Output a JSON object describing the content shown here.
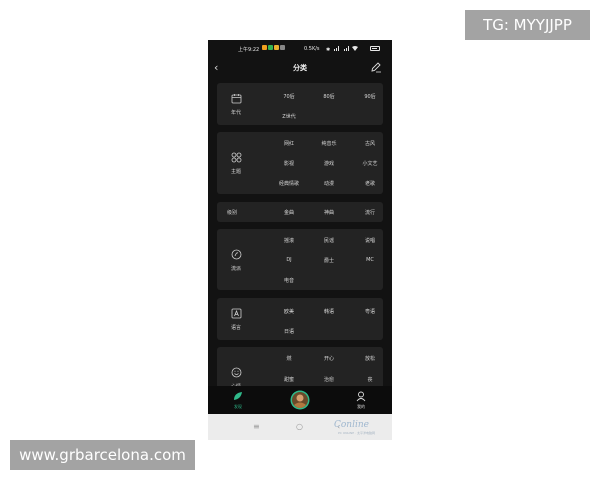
{
  "watermarks": {
    "top_right": "TG: MYYJJPP",
    "bottom_left": "www.grbarcelona.com"
  },
  "status_bar": {
    "time": "上午9:22",
    "right": "0.5K/s"
  },
  "header": {
    "title": "分类"
  },
  "sections": {
    "era": {
      "label": "年代",
      "options": [
        "70后",
        "80后",
        "90后",
        "Z世代"
      ]
    },
    "theme": {
      "label": "主题",
      "options": [
        "网红",
        "纯音乐",
        "古风",
        "影视",
        "游戏",
        "小文艺",
        "经典情歌",
        "动漫",
        "老歌"
      ]
    },
    "level": {
      "label": "级别",
      "options": [
        "金曲",
        "神曲",
        "流行"
      ]
    },
    "genre": {
      "label": "流派",
      "options": [
        "摇滚",
        "民谣",
        "说唱",
        "DJ",
        "爵士",
        "MC",
        "电音"
      ]
    },
    "language": {
      "label": "语言",
      "options": [
        "欧美",
        "韩语",
        "粤语",
        "日语"
      ]
    },
    "mood": {
      "label": "心情",
      "options": [
        "燃",
        "开心",
        "放松",
        "甜蜜",
        "治愈",
        "丧"
      ]
    }
  },
  "tabbar": {
    "discover": "发现",
    "mine": "我的"
  },
  "system_nav": {
    "brand": "Conline",
    "brand_sub": "PC ONLINE · 太平洋电脑网"
  },
  "colors": {
    "accent": "#2fb98a",
    "background": "#121212",
    "card": "#232323"
  }
}
